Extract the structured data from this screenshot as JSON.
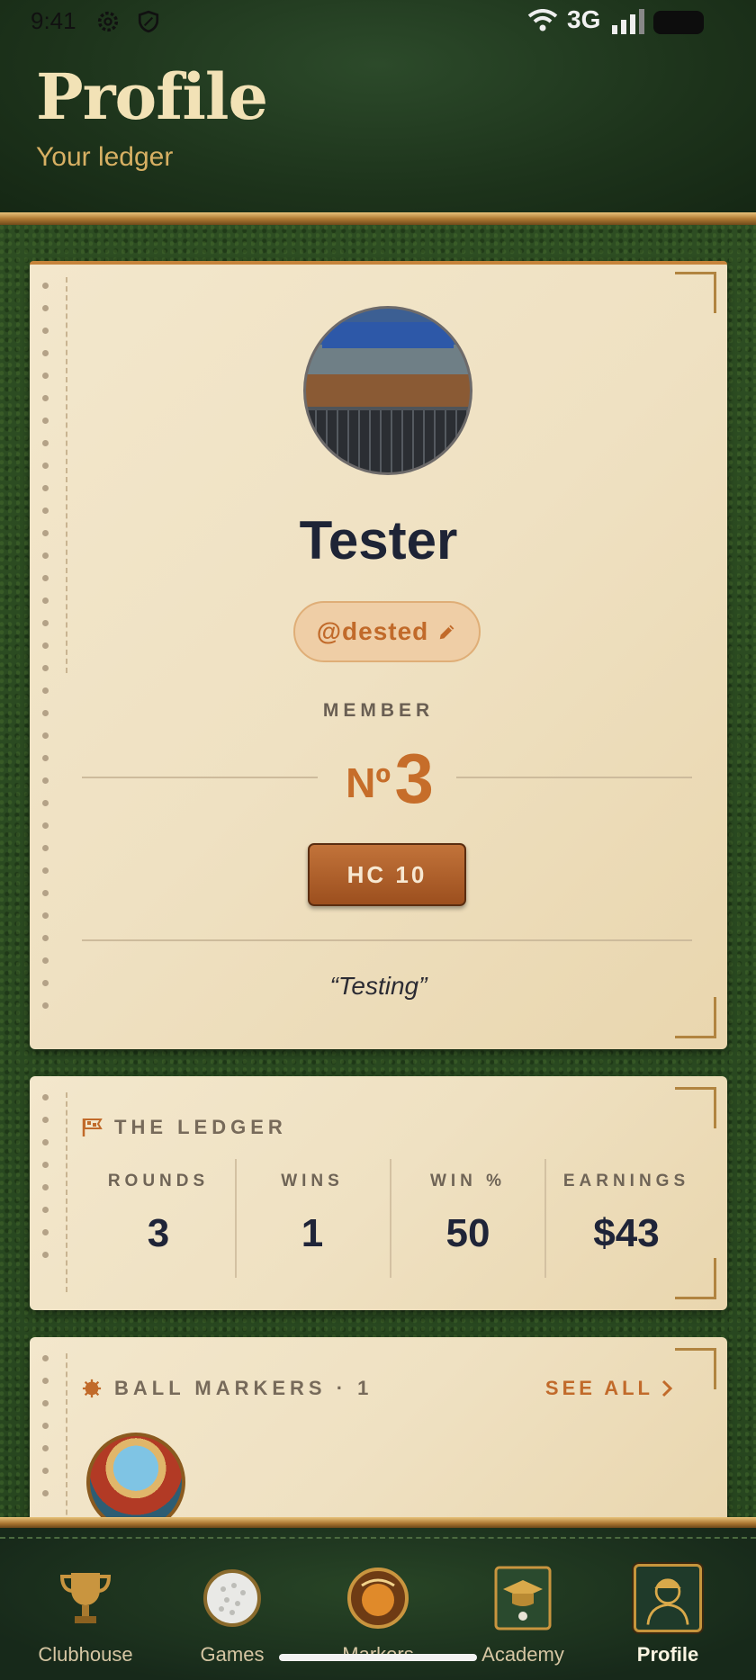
{
  "status_bar": {
    "time": "9:41",
    "network": "3G"
  },
  "header": {
    "title": "Profile",
    "subtitle": "Your ledger"
  },
  "profile": {
    "name": "Tester",
    "handle": "@dested",
    "member_label": "MEMBER",
    "member_prefix": "Nº",
    "member_number": "3",
    "handicap": "HC 10",
    "bio": "“Testing”"
  },
  "ledger": {
    "title": "THE LEDGER",
    "stats": [
      {
        "label": "ROUNDS",
        "value": "3"
      },
      {
        "label": "WINS",
        "value": "1"
      },
      {
        "label": "WIN %",
        "value": "50"
      },
      {
        "label": "EARNINGS",
        "value": "$43"
      }
    ]
  },
  "markers": {
    "title": "BALL MARKERS · 1",
    "see_all": "SEE ALL"
  },
  "nav": {
    "items": [
      {
        "label": "Clubhouse",
        "icon": "trophy-icon"
      },
      {
        "label": "Games",
        "icon": "golf-ball-icon"
      },
      {
        "label": "Markers",
        "icon": "ball-marker-icon"
      },
      {
        "label": "Academy",
        "icon": "graduation-cap-icon"
      },
      {
        "label": "Profile",
        "icon": "golfer-profile-icon"
      }
    ],
    "active": "Profile"
  },
  "colors": {
    "accent": "#c16a2a",
    "header_bg": "#1d331b",
    "card_bg": "#f1e4c7",
    "text_dark": "#1e2436",
    "gold": "#d7b063"
  }
}
